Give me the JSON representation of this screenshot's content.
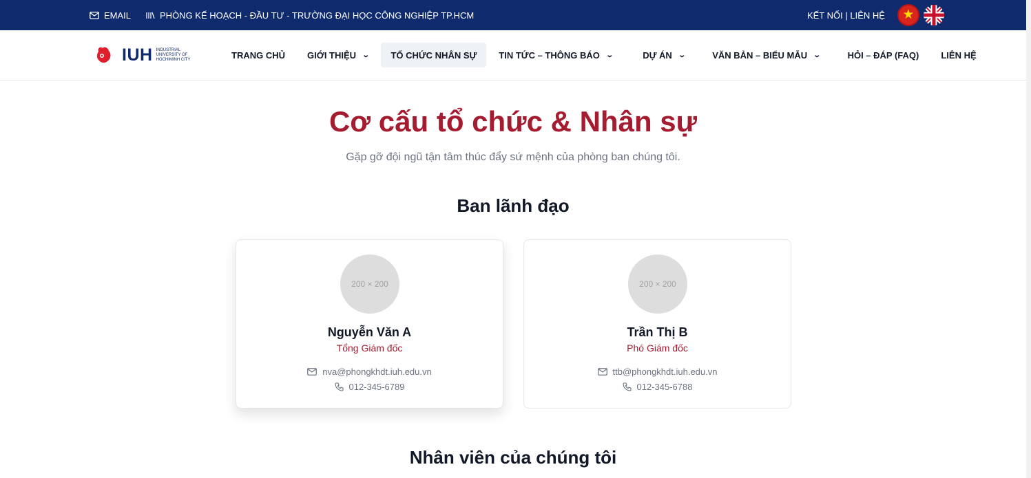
{
  "topbar": {
    "email_label": "EMAIL",
    "org_label": "PHÒNG KẾ HOẠCH - ĐẦU TƯ - TRƯỜNG ĐẠI HỌC CÔNG NGHIỆP TP.HCM",
    "links_label": "KẾT NỐI | LIÊN HỆ"
  },
  "logo": {
    "text": "IUH",
    "subtitle": "INDUSTRIAL UNIVERSITY OF HOCHIMINH CITY"
  },
  "nav": {
    "items": [
      {
        "label": "TRANG CHỦ"
      },
      {
        "label": "GIỚI THIỆU"
      },
      {
        "label": "TỔ CHỨC NHÂN SỰ"
      },
      {
        "label": "TIN TỨC – THÔNG BÁO"
      },
      {
        "label": "DỰ ÁN"
      },
      {
        "label": "VĂN BẢN – BIỂU MẪU"
      },
      {
        "label": "HỎI – ĐÁP (FAQ)"
      },
      {
        "label": "LIÊN HỆ"
      }
    ]
  },
  "page": {
    "title": "Cơ cấu tổ chức & Nhân sự",
    "subtitle": "Gặp gỡ đội ngũ tận tâm thúc đẩy sứ mệnh của phòng ban chúng tôi."
  },
  "leadership": {
    "title": "Ban lãnh đạo",
    "members": [
      {
        "avatar": "200 × 200",
        "name": "Nguyễn Văn A",
        "role": "Tổng Giám đốc",
        "email": "nva@phongkhdt.iuh.edu.vn",
        "phone": "012-345-6789"
      },
      {
        "avatar": "200 × 200",
        "name": "Trần Thị B",
        "role": "Phó Giám đốc",
        "email": "ttb@phongkhdt.iuh.edu.vn",
        "phone": "012-345-6788"
      }
    ]
  },
  "staff": {
    "title": "Nhân viên của chúng tôi"
  },
  "colors": {
    "brand_navy": "#0f2b6e",
    "accent_red": "#a51c30"
  }
}
